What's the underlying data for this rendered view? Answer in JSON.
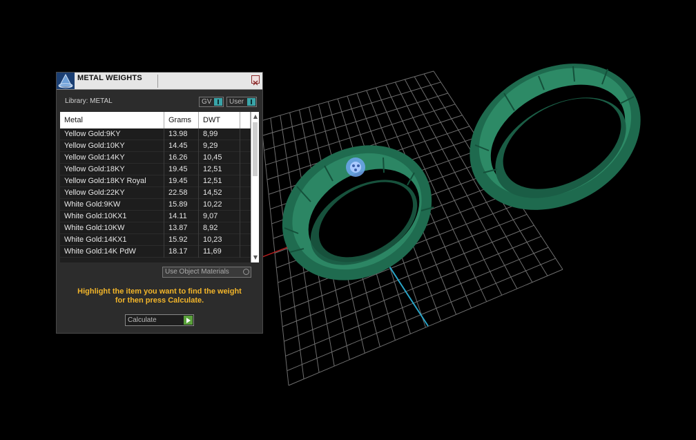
{
  "panel": {
    "title": "METAL WEIGHTS",
    "library_label": "Library: METAL",
    "toggle_gv": "GV",
    "toggle_user": "User",
    "use_object_materials": "Use Object Materials",
    "hint_line1": "Highlight the item you want to find the weight",
    "hint_line2": "for then press Calculate.",
    "calculate_label": "Calculate"
  },
  "table": {
    "headers": [
      "Metal",
      "Grams",
      "DWT"
    ],
    "rows": [
      {
        "metal": "Yellow Gold:9KY",
        "grams": "13.98",
        "dwt": "8,99"
      },
      {
        "metal": "Yellow Gold:10KY",
        "grams": "14.45",
        "dwt": "9,29"
      },
      {
        "metal": "Yellow Gold:14KY",
        "grams": "16.26",
        "dwt": "10,45"
      },
      {
        "metal": "Yellow Gold:18KY",
        "grams": "19.45",
        "dwt": "12,51"
      },
      {
        "metal": "Yellow Gold:18KY Royal",
        "grams": "19.45",
        "dwt": "12,51"
      },
      {
        "metal": "Yellow Gold:22KY",
        "grams": "22.58",
        "dwt": "14,52"
      },
      {
        "metal": "White Gold:9KW",
        "grams": "15.89",
        "dwt": "10,22"
      },
      {
        "metal": "White Gold:10KX1",
        "grams": "14.11",
        "dwt": "9,07"
      },
      {
        "metal": "White Gold:10KW",
        "grams": "13.87",
        "dwt": "8,92"
      },
      {
        "metal": "White Gold:14KX1",
        "grams": "15.92",
        "dwt": "10,23"
      },
      {
        "metal": "White Gold:14K PdW",
        "grams": "18.17",
        "dwt": "11,69"
      }
    ]
  },
  "colors": {
    "ring": "#1f6b4f",
    "ring_light": "#2e8a66",
    "grid": "#7a7a7a",
    "axis_red": "#b01e1e",
    "axis_blue": "#2aa6c9",
    "hint": "#f2b52a",
    "accent_teal": "#3aa5a9"
  }
}
